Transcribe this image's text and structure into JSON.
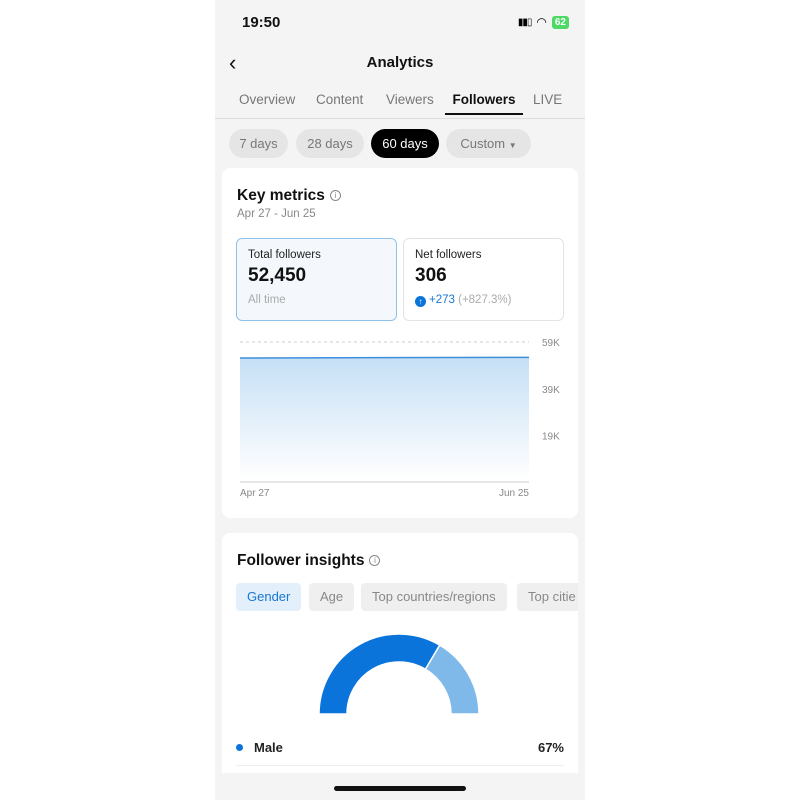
{
  "status_bar": {
    "time": "19:50",
    "battery": "62"
  },
  "header": {
    "title": "Analytics",
    "back_icon": "chevron-left-icon"
  },
  "tabs": [
    {
      "label": "Overview"
    },
    {
      "label": "Content"
    },
    {
      "label": "Viewers"
    },
    {
      "label": "Followers",
      "active": true
    },
    {
      "label": "LIVE"
    }
  ],
  "ranges": [
    {
      "label": "7 days"
    },
    {
      "label": "28 days"
    },
    {
      "label": "60 days",
      "active": true
    },
    {
      "label": "Custom"
    }
  ],
  "key_metrics": {
    "title": "Key metrics",
    "date_range": "Apr 27 - Jun 25",
    "total": {
      "label": "Total followers",
      "value": "52,450",
      "footnote": "All time"
    },
    "net": {
      "label": "Net followers",
      "value": "306",
      "change": "+273",
      "change_pct": "(+827.3%)"
    }
  },
  "chart_data": {
    "type": "area",
    "x": [
      "Apr 27",
      "Jun 25"
    ],
    "values": [
      52144,
      52450
    ],
    "ylim": [
      0,
      59000
    ],
    "yticks": [
      "59K",
      "39K",
      "19K"
    ],
    "ytick_values": [
      59000,
      39000,
      19000
    ],
    "xtick_labels": [
      "Apr 27",
      "Jun 25"
    ],
    "grid": true,
    "color": "#3d8fdc"
  },
  "insights": {
    "title": "Follower insights",
    "chips": [
      {
        "label": "Gender",
        "active": true
      },
      {
        "label": "Age"
      },
      {
        "label": "Top countries/regions"
      },
      {
        "label": "Top citie"
      }
    ],
    "gender_chart": {
      "type": "pie",
      "segments": [
        {
          "label": "Male",
          "value": 67,
          "color": "#0a74da"
        },
        {
          "value": 33,
          "color": "#7fb9ea"
        }
      ]
    },
    "legend": [
      {
        "label": "Male",
        "value": "67%",
        "color": "#0a74da"
      }
    ]
  }
}
